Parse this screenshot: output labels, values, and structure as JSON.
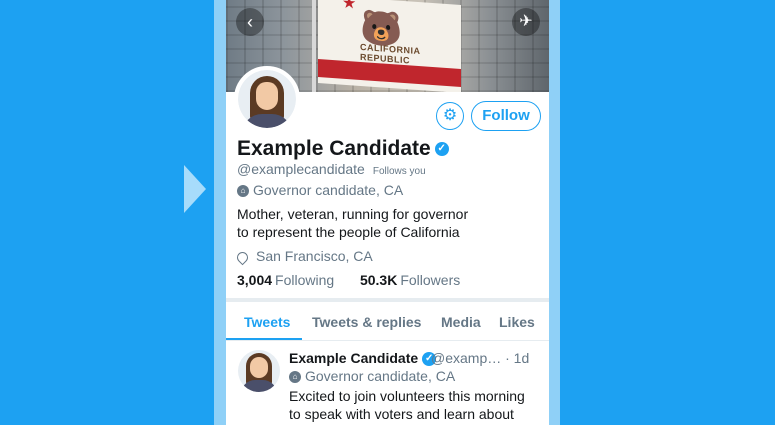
{
  "profile": {
    "name": "Example Candidate",
    "handle": "@examplecandidate",
    "follows_you": "Follows you",
    "label": "Governor candidate, CA",
    "bio_line1": "Mother, veteran, running for governor",
    "bio_line2": "to represent the people of California",
    "location": "San Francisco, CA",
    "following_count": "3,004",
    "following_label": "Following",
    "followers_count": "50.3K",
    "followers_label": "Followers"
  },
  "header": {
    "flag_text": "CALIFORNIA REPUBLIC"
  },
  "actions": {
    "follow_label": "Follow"
  },
  "tabs": [
    {
      "label": "Tweets",
      "active": true
    },
    {
      "label": "Tweets & replies",
      "active": false
    },
    {
      "label": "Media",
      "active": false
    },
    {
      "label": "Likes",
      "active": false
    }
  ],
  "tweet": {
    "name": "Example Candidate",
    "handle": "@examp…",
    "time": "· 1d",
    "label": "Governor candidate, CA",
    "text": "Excited to join volunteers this morning to speak with voters and learn about"
  },
  "colors": {
    "accent": "#1da1f2",
    "text": "#14171a",
    "secondary": "#657786"
  },
  "icons": [
    "back-arrow-icon",
    "airplane-icon",
    "gear-icon",
    "verified-badge-icon",
    "government-label-icon",
    "location-pin-icon",
    "play-arrow-icon"
  ]
}
